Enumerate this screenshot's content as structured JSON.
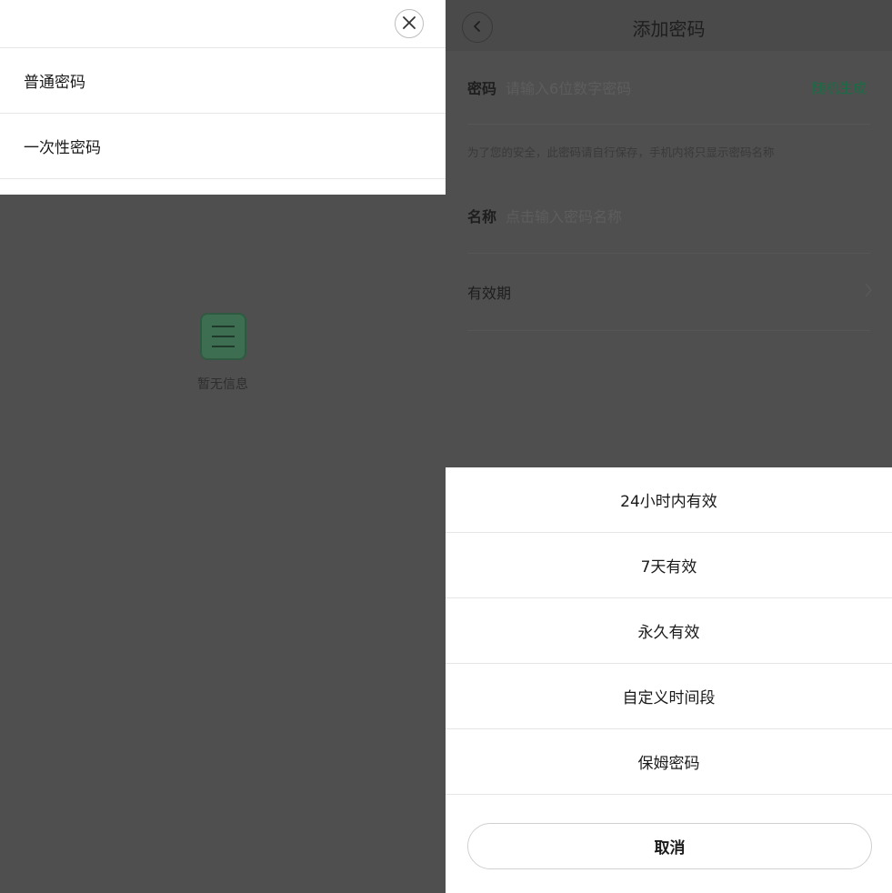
{
  "left": {
    "sheet": {
      "items": [
        {
          "label": "普通密码"
        },
        {
          "label": "一次性密码"
        }
      ]
    },
    "empty_text": "暂无信息"
  },
  "right": {
    "title": "添加密码",
    "password": {
      "label": "密码",
      "placeholder": "请输入6位数字密码",
      "action": "随机生成"
    },
    "hint": "为了您的安全，此密码请自行保存，手机内将只显示密码名称",
    "name": {
      "label": "名称",
      "placeholder": "点击输入密码名称"
    },
    "validity": {
      "label": "有效期"
    },
    "action_sheet": {
      "options": [
        {
          "label": "24小时内有效"
        },
        {
          "label": "7天有效"
        },
        {
          "label": "永久有效"
        },
        {
          "label": "自定义时间段"
        },
        {
          "label": "保姆密码"
        }
      ],
      "cancel": "取消"
    }
  },
  "colors": {
    "accent_green": "#1d6b45",
    "overlay": "#4f4f4f"
  },
  "icons": [
    "close-icon",
    "empty-list-icon",
    "back-icon",
    "chevron-right-icon"
  ]
}
